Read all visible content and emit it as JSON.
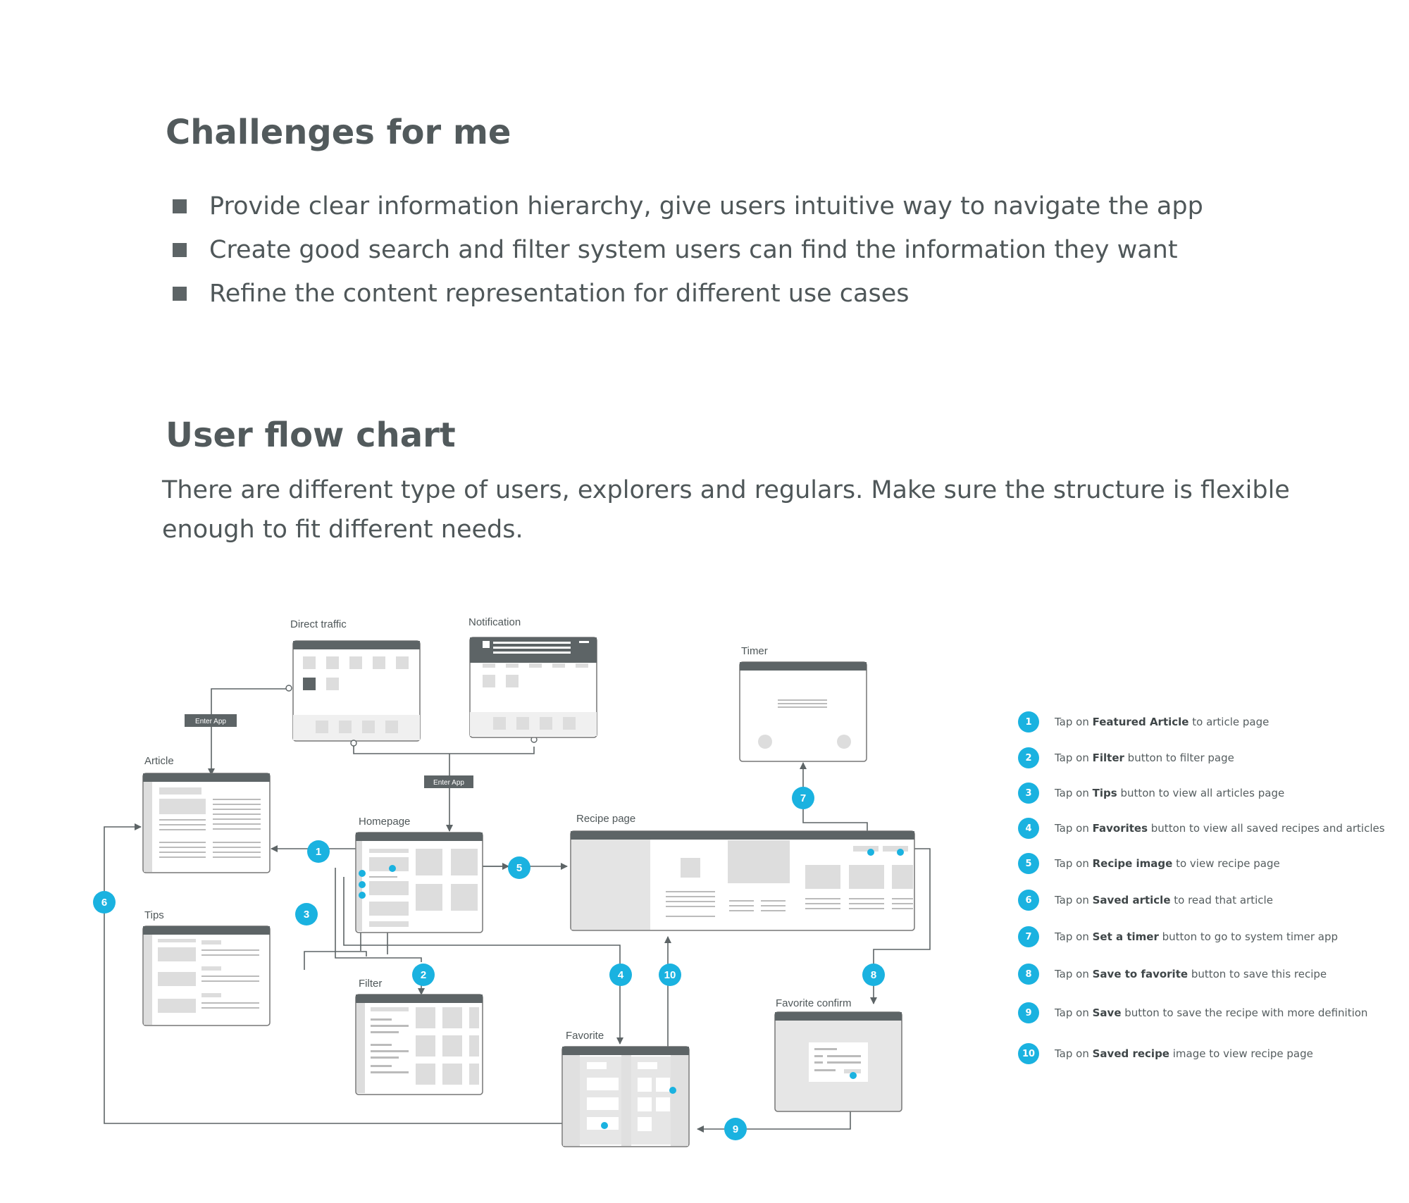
{
  "challenges": {
    "title": "Challenges for me",
    "items": [
      "Provide clear information hierarchy, give users intuitive way to navigate the app",
      "Create good search and filter system users can find the information they want",
      "Refine the content representation for different use cases"
    ]
  },
  "flow": {
    "title": "User flow chart",
    "intro": "There are different type of users, explorers and regulars. Make sure the structure is flexible enough to fit different needs.",
    "screens": {
      "direct_traffic": "Direct traffic",
      "notification": "Notification",
      "timer": "Timer",
      "article": "Article",
      "homepage": "Homepage",
      "recipe_page": "Recipe page",
      "tips": "Tips",
      "filter": "Filter",
      "favorite": "Favorite",
      "favorite_confirm": "Favorite confirm"
    },
    "tags": {
      "enter_app_1": "Enter App",
      "enter_app_2": "Enter App"
    },
    "steps": [
      "1",
      "2",
      "3",
      "4",
      "5",
      "6",
      "7",
      "8",
      "9",
      "10"
    ],
    "accent_color": "#1ab2e0",
    "frame_color": "#5d6466"
  },
  "legend": [
    {
      "num": "1",
      "pre": "Tap on ",
      "bold": "Featured Article",
      "post": " to article page"
    },
    {
      "num": "2",
      "pre": "Tap on ",
      "bold": "Filter",
      "post": " button to filter page"
    },
    {
      "num": "3",
      "pre": "Tap on ",
      "bold": "Tips",
      "post": " button to view all articles page"
    },
    {
      "num": "4",
      "pre": "Tap on ",
      "bold": "Favorites",
      "post": " button to view all saved recipes and articles"
    },
    {
      "num": "5",
      "pre": "Tap on ",
      "bold": "Recipe image",
      "post": " to view recipe page"
    },
    {
      "num": "6",
      "pre": "Tap on ",
      "bold": "Saved article",
      "post": " to read that article"
    },
    {
      "num": "7",
      "pre": "Tap on ",
      "bold": "Set a timer",
      "post": " button to go to system timer app"
    },
    {
      "num": "8",
      "pre": "Tap on ",
      "bold": "Save to favorite",
      "post": " button to save this recipe"
    },
    {
      "num": "9",
      "pre": "Tap on ",
      "bold": "Save",
      "post": " button to save the recipe with more definition"
    },
    {
      "num": "10",
      "pre": "Tap on ",
      "bold": "Saved recipe",
      "post": " image to view recipe page"
    }
  ]
}
